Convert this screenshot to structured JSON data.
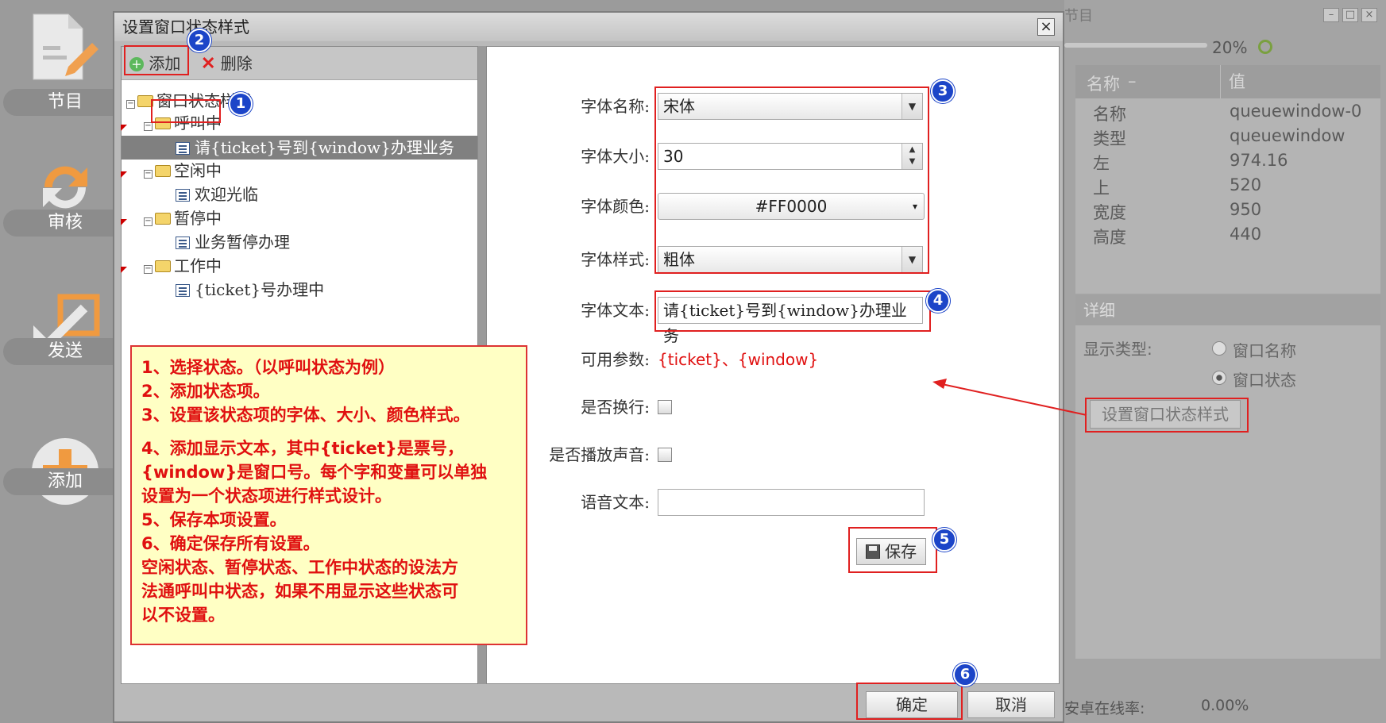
{
  "sidebar": {
    "items": [
      {
        "label": "节目",
        "icon": "document-edit-icon"
      },
      {
        "label": "审核",
        "icon": "refresh-icon"
      },
      {
        "label": "发送",
        "icon": "send-arrow-icon"
      },
      {
        "label": "添加",
        "icon": "plus-circle-icon"
      }
    ]
  },
  "background_panel": {
    "window_title": "节目",
    "zoom": "20%",
    "prop_header_name": "名称",
    "prop_header_sort": "–",
    "prop_header_value": "值",
    "properties": [
      {
        "name": "名称",
        "value": "queuewindow-0"
      },
      {
        "name": "类型",
        "value": "queuewindow"
      },
      {
        "name": "左",
        "value": "974.16"
      },
      {
        "name": "上",
        "value": "520"
      },
      {
        "name": "宽度",
        "value": "950"
      },
      {
        "name": "高度",
        "value": "440"
      }
    ],
    "detail_title": "详细",
    "display_type_label": "显示类型:",
    "radio_window_name": "窗口名称",
    "radio_window_status": "窗口状态",
    "set_status_style_button": "设置窗口状态样式",
    "online_rate_label": "安卓在线率:",
    "online_rate_value": "0.00%"
  },
  "dialog": {
    "title": "设置窗口状态样式",
    "close": "×",
    "toolbar": {
      "add": "添加",
      "delete": "删除"
    },
    "tree": {
      "root": "窗口状态样式",
      "nodes": [
        {
          "label": "呼叫中",
          "child": "请{ticket}号到{window}办理业务"
        },
        {
          "label": "空闲中",
          "child": "欢迎光临"
        },
        {
          "label": "暂停中",
          "child": "业务暂停办理"
        },
        {
          "label": "工作中",
          "child": "{ticket}号办理中"
        }
      ]
    },
    "form": {
      "font_name_label": "字体名称:",
      "font_name_value": "宋体",
      "font_size_label": "字体大小:",
      "font_size_value": "30",
      "font_color_label": "字体颜色:",
      "font_color_value": "#FF0000",
      "font_style_label": "字体样式:",
      "font_style_value": "粗体",
      "font_text_label": "字体文本:",
      "font_text_value": "请{ticket}号到{window}办理业务",
      "params_label": "可用参数:",
      "params_value": "{ticket}、{window}",
      "wrap_label": "是否换行:",
      "sound_label": "是否播放声音:",
      "voice_text_label": "语音文本:",
      "voice_text_value": "",
      "save_button": "保存"
    },
    "ok_button": "确定",
    "cancel_button": "取消"
  },
  "badges": [
    "1",
    "2",
    "3",
    "4",
    "5",
    "6"
  ],
  "note": {
    "lines": [
      "1、选择状态。（以呼叫状态为例）",
      "2、添加状态项。",
      "3、设置该状态项的字体、大小、颜色样式。",
      "4、添加显示文本，其中{ticket}是票号，",
      "{window}是窗口号。每个字和变量可以单独",
      "设置为一个状态项进行样式设计。",
      "5、保存本项设置。",
      "6、确定保存所有设置。",
      "空闲状态、暂停状态、工作中状态的设法方",
      "法通呼叫中状态，如果不用显示这些状态可",
      "以不设置。"
    ]
  },
  "colors": {
    "annotation_red": "#e02020",
    "badge_blue": "#1c45c8",
    "note_bg": "#ffffc4",
    "param_red": "#e01010"
  }
}
